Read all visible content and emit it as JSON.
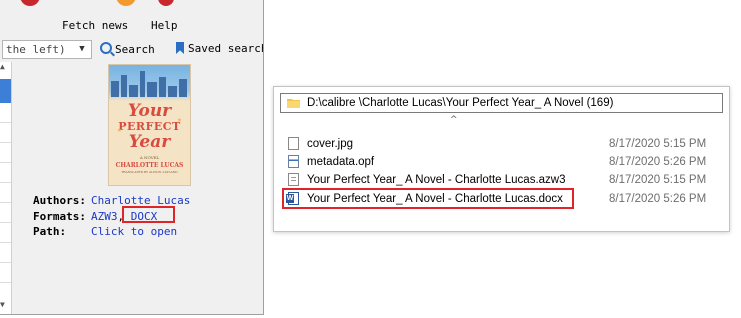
{
  "calibre": {
    "toolbar": {
      "fetch_news_label": "Fetch news",
      "help_label": "Help"
    },
    "search": {
      "combo_text": "the left)",
      "search_label": "Search",
      "saved_search_label": "Saved search"
    },
    "book": {
      "cover_title_line1": "Your",
      "cover_title_line2": "PERFECT",
      "cover_title_line3": "Year",
      "cover_subtitle": "A NOVEL",
      "cover_author": "CHARLOTTE LUCAS",
      "cover_tagline": "TRANSLATED BY ALISON LAYLAND",
      "authors_key": "Authors:",
      "authors_value": "Charlotte Lucas",
      "formats_key": "Formats:",
      "format_azw3": "AZW3",
      "format_separator": ",",
      "format_docx": "DOCX",
      "path_key": "Path:",
      "path_value": "Click to open"
    },
    "highlight_color": "#e0242b",
    "link_color": "#1a38c8"
  },
  "explorer": {
    "address": "D:\\calibre \\Charlotte Lucas\\Your Perfect Year_ A Novel (169)",
    "files": [
      {
        "icon": "file-icon",
        "name": "cover.jpg",
        "date": "8/17/2020 5:15 PM"
      },
      {
        "icon": "opf-file-icon",
        "name": "metadata.opf",
        "date": "8/17/2020 5:26 PM"
      },
      {
        "icon": "azw3-file-icon",
        "name": "Your Perfect Year_ A Novel - Charlotte Lucas.azw3",
        "date": "8/17/2020 5:15 PM"
      },
      {
        "icon": "word-docx-icon",
        "name": "Your Perfect Year_ A Novel - Charlotte Lucas.docx",
        "date": "8/17/2020 5:26 PM"
      }
    ]
  }
}
